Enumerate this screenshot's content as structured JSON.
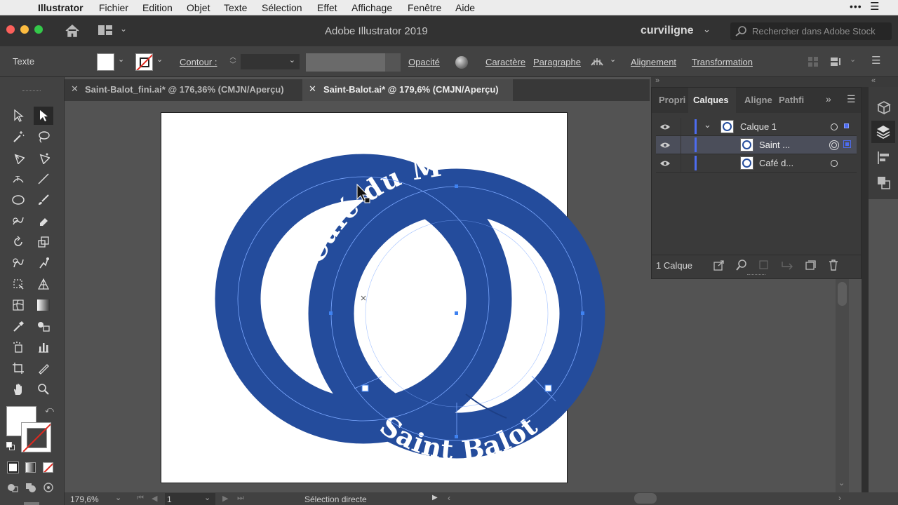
{
  "menubar": {
    "app_name": "Illustrator",
    "items": [
      "Fichier",
      "Edition",
      "Objet",
      "Texte",
      "Sélection",
      "Effet",
      "Affichage",
      "Fenêtre",
      "Aide"
    ]
  },
  "appbar": {
    "title": "Adobe Illustrator 2019",
    "workspace": "curviligne",
    "search_placeholder": "Rechercher dans Adobe Stock"
  },
  "controlbar": {
    "selection_label": "Texte",
    "contour_label": "Contour :",
    "opacity_label": "Opacité",
    "caractere_label": "Caractère",
    "paragraphe_label": "Paragraphe",
    "alignement_label": "Alignement",
    "transformation_label": "Transformation"
  },
  "tabs": [
    {
      "label": "Saint-Balot_fini.ai* @ 176,36% (CMJN/Aperçu)",
      "active": false
    },
    {
      "label": "Saint-Balot.ai* @ 179,6% (CMJN/Aperçu)",
      "active": true
    }
  ],
  "artwork": {
    "top_text": "Café du M",
    "bottom_text": "Saint Balot",
    "ring_color": "#244c9c"
  },
  "layers_panel": {
    "tabs": [
      "Propri",
      "Calques",
      "Aligne",
      "Pathfi"
    ],
    "active_tab": "Calques",
    "rows": [
      {
        "name": "Calque 1",
        "selected": false
      },
      {
        "name": "Saint ...",
        "selected": true
      },
      {
        "name": "Café d...",
        "selected": false
      }
    ],
    "footer_count": "1 Calque"
  },
  "statusbar": {
    "zoom": "179,6%",
    "artboard_number": "1",
    "tool_name": "Sélection directe"
  },
  "colors": {
    "accent": "#3f82f0",
    "layer_color": "#4d6cf0",
    "ring": "#244c9c"
  }
}
